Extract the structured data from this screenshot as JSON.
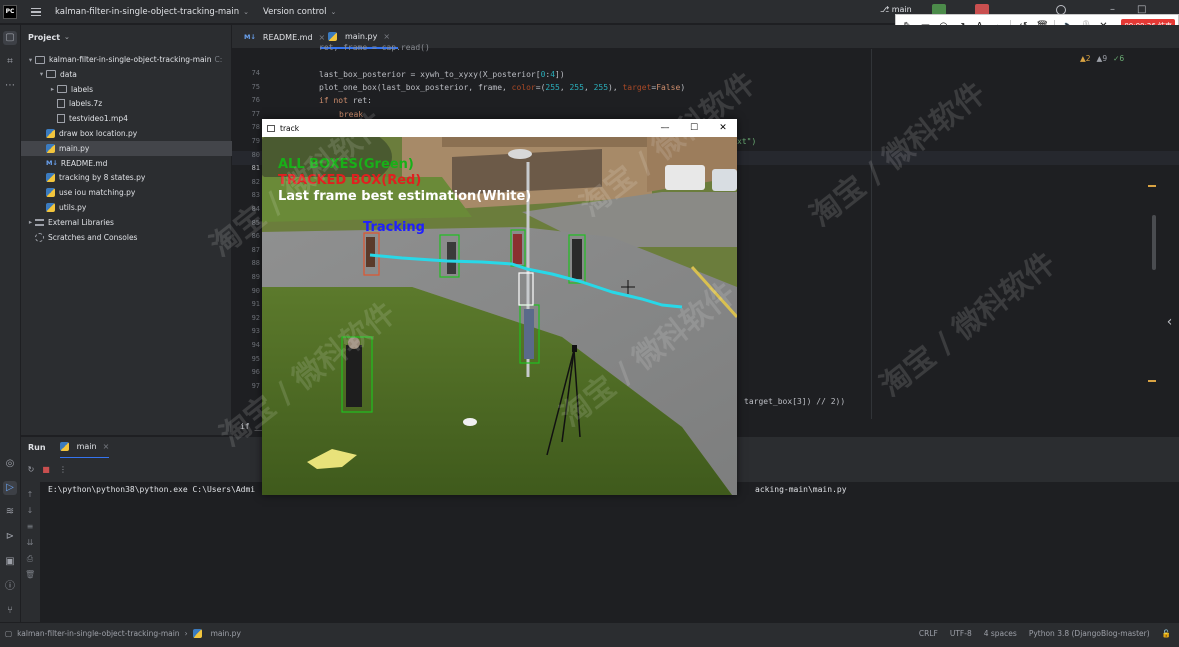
{
  "titlebar": {
    "app_logo": "PC",
    "project_name": "kalman-filter-in-single-object-tracking-main",
    "version_control": "Version control",
    "branch": "main"
  },
  "recording_toolbar": {
    "timer": "00:00:26 结束",
    "tools": [
      "pen-icon",
      "rectangle-icon",
      "circle-icon",
      "arrow-icon",
      "text-icon",
      "marker-icon",
      "undo-icon",
      "trash-icon",
      "volume-icon",
      "mic-icon",
      "close-icon"
    ]
  },
  "project_panel": {
    "title": "Project",
    "tree": [
      {
        "label": "kalman-filter-in-single-object-tracking-main",
        "suffix": "C:",
        "kind": "folder",
        "indent": 0,
        "arrow": "▾"
      },
      {
        "label": "data",
        "kind": "folder",
        "indent": 1,
        "arrow": "▾"
      },
      {
        "label": "labels",
        "kind": "folder",
        "indent": 2,
        "arrow": "▸"
      },
      {
        "label": "labels.7z",
        "kind": "file",
        "indent": 2,
        "arrow": ""
      },
      {
        "label": "testvideo1.mp4",
        "kind": "file",
        "indent": 2,
        "arrow": ""
      },
      {
        "label": "draw box location.py",
        "kind": "py",
        "indent": 1,
        "arrow": ""
      },
      {
        "label": "main.py",
        "kind": "py",
        "indent": 1,
        "arrow": "",
        "selected": true
      },
      {
        "label": "README.md",
        "kind": "md",
        "indent": 1,
        "arrow": ""
      },
      {
        "label": "tracking by 8 states.py",
        "kind": "py",
        "indent": 1,
        "arrow": ""
      },
      {
        "label": "use iou matching.py",
        "kind": "py",
        "indent": 1,
        "arrow": ""
      },
      {
        "label": "utils.py",
        "kind": "py",
        "indent": 1,
        "arrow": ""
      },
      {
        "label": "External Libraries",
        "kind": "lib",
        "indent": 0,
        "arrow": "▸"
      },
      {
        "label": "Scratches and Consoles",
        "kind": "scratch",
        "indent": 0,
        "arrow": ""
      }
    ]
  },
  "editor": {
    "tabs": [
      {
        "label": "README.md",
        "icon": "M↓"
      },
      {
        "label": "main.py",
        "icon": "py"
      }
    ],
    "inspections": {
      "warnings": "▲2",
      "weak": "▲9",
      "typos": "✓6"
    },
    "line_numbers": [
      "74",
      "75",
      "76",
      "77",
      "78",
      "79",
      "80",
      "81",
      "82",
      "83",
      "84",
      "85",
      "86",
      "87",
      "88",
      "89",
      "90",
      "91",
      "92",
      "93",
      "94",
      "95",
      "96",
      "97"
    ],
    "current_line": "81",
    "code_top": "ret, frame = cap.read()",
    "code_line1_a": "last_box_posterior = xywh_to_xyxy(X_posterior[",
    "code_line1_b": "0",
    "code_line1_c": ":",
    "code_line1_d": "4",
    "code_line1_e": "])",
    "code_line2_a": "plot_one_box(last_box_posterior, frame, ",
    "code_line2_b": "color",
    "code_line2_c": "=(",
    "code_line2_d": "255",
    "code_line2_e": ", ",
    "code_line2_f": "255",
    "code_line2_g": ", ",
    "code_line2_h": "255",
    "code_line2_i": "), ",
    "code_line2_j": "target",
    "code_line2_k": "=",
    "code_line2_l": "False",
    "code_line2_m": ")",
    "code_line3_kw": "if not",
    "code_line3_rest": " ret:",
    "code_line4": "break",
    "code_right_frag": "xt\")",
    "code_bottom_frag": "target_box[3]) // 2))",
    "code_left_frag": "if __n"
  },
  "run_panel": {
    "title": "Run",
    "tab": "main",
    "console_cmd": "E:\\python\\python38\\python.exe C:\\Users\\Admi",
    "console_tail": "acking-main\\main.py"
  },
  "statusbar": {
    "path_project": "kalman-filter-in-single-object-tracking-main",
    "path_file": "main.py",
    "line_sep": "CRLF",
    "encoding": "UTF-8",
    "indent": "4 spaces",
    "interpreter": "Python 3.8 (DjangoBlog-master)"
  },
  "track_window": {
    "title": "track",
    "legend_all": "ALL BOXES(Green)",
    "legend_tracked": "TRACKED BOX(Red)",
    "legend_last": "Last frame best estimation(White)",
    "tracking_label": "Tracking",
    "colors": {
      "green": "#18b018",
      "red": "#e02020",
      "white": "#ffffff",
      "blue": "#2020ff",
      "trail": "#28d8e8"
    }
  },
  "watermark": "淘宝 / 微科软件"
}
